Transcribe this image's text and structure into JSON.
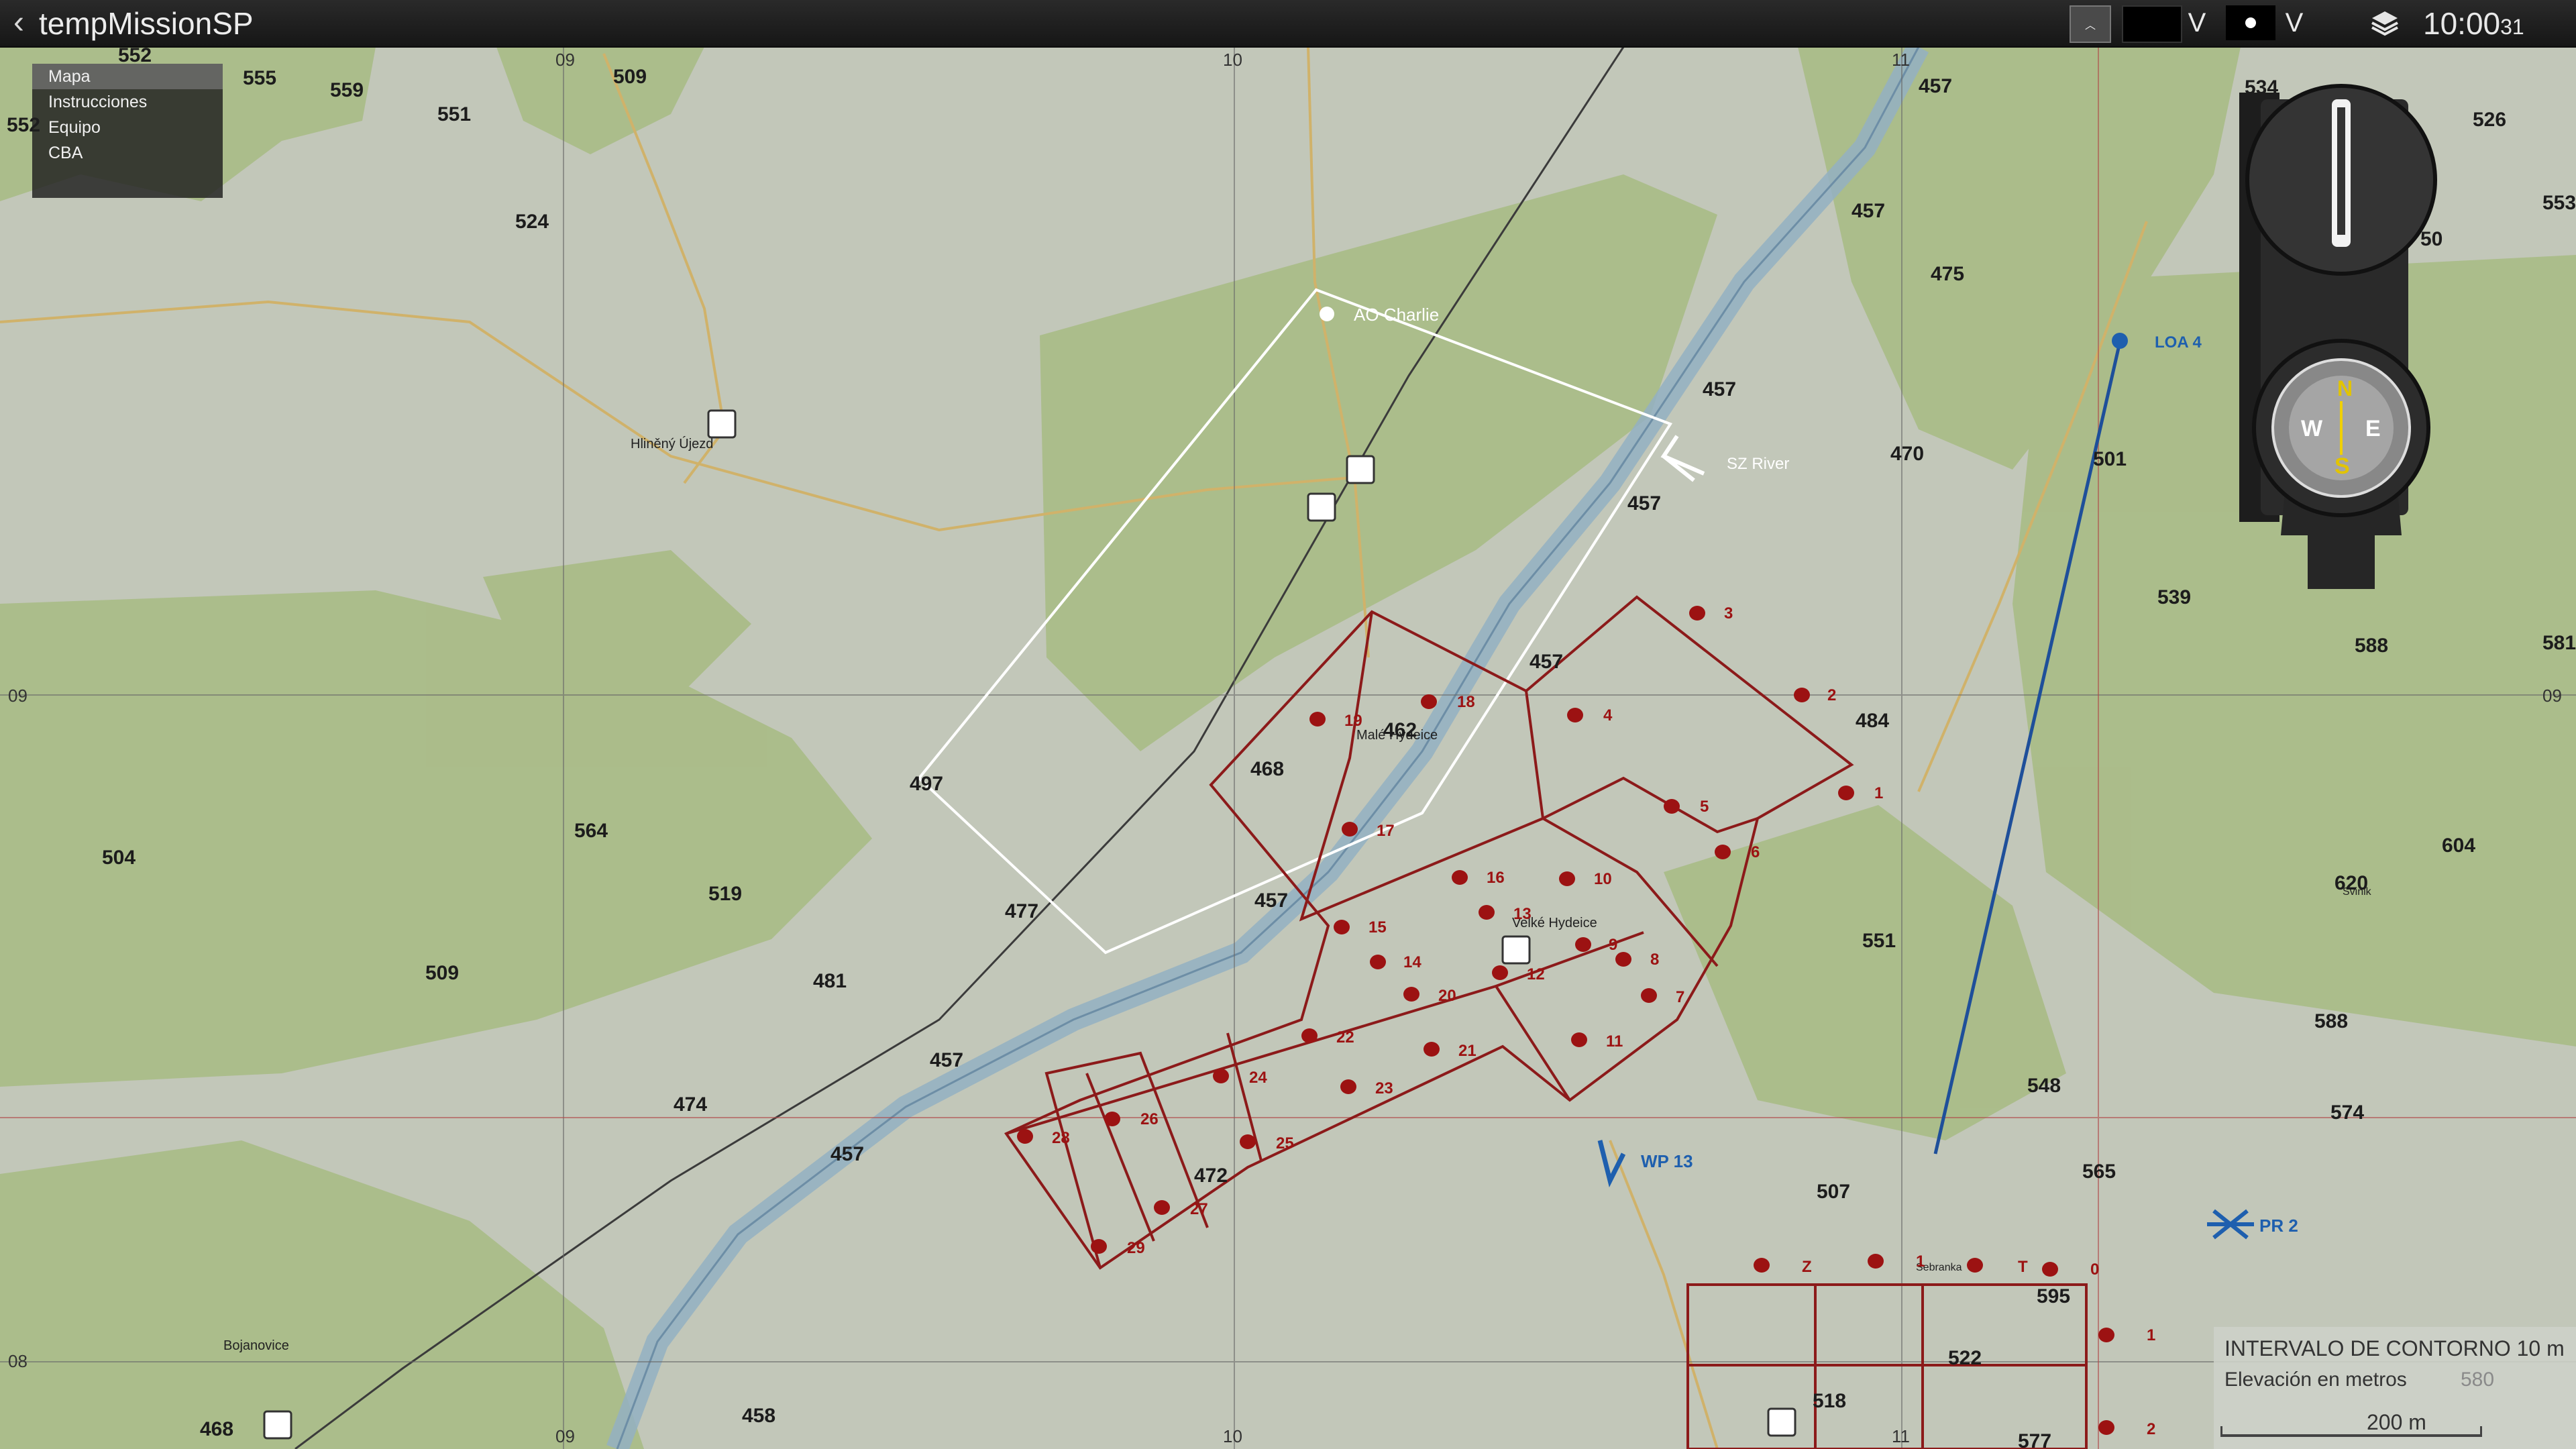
{
  "window": {
    "title": "tempMissionSP"
  },
  "toolbar": {
    "back_icon": "chevron-left-icon",
    "clock_time": "10:00",
    "clock_seconds": "31",
    "v1": "V",
    "v2": "V",
    "icons": [
      "chevron-up-icon",
      "color-swatch-icon",
      "marker-dot-icon",
      "layers-icon"
    ]
  },
  "briefing_menu": {
    "items": [
      "Mapa",
      "Instrucciones",
      "Equipo",
      "CBA"
    ],
    "active": "Mapa"
  },
  "grid": {
    "x_labels": [
      "09",
      "10",
      "11"
    ],
    "y_labels": [
      "09",
      "08"
    ]
  },
  "elevations": [
    "552",
    "555",
    "559",
    "551",
    "509",
    "524",
    "457",
    "534",
    "526",
    "457",
    "475",
    "457",
    "470",
    "501",
    "539",
    "588",
    "484",
    "457",
    "468",
    "462",
    "457",
    "497",
    "504",
    "564",
    "519",
    "509",
    "481",
    "477",
    "457",
    "551",
    "620",
    "604",
    "588",
    "574",
    "457",
    "474",
    "457",
    "472",
    "548",
    "565",
    "507",
    "595",
    "522",
    "518",
    "577",
    "458",
    "468",
    "552",
    "553",
    "50",
    "581"
  ],
  "places": [
    "Hliněný Újezd",
    "Malé Hydeice",
    "Velké Hydeice",
    "Bojanovice",
    "Sebranka",
    "Svinik"
  ],
  "markers": {
    "ao": "AO Charlie",
    "river": "SZ River",
    "loa": "LOA 4",
    "waypoint": "WP 13",
    "pr": "PR 2",
    "sector_numbers": [
      "1",
      "2",
      "3",
      "4",
      "5",
      "6",
      "7",
      "8",
      "9",
      "10",
      "11",
      "12",
      "13",
      "14",
      "15",
      "16",
      "17",
      "18",
      "19",
      "20",
      "21",
      "22",
      "23",
      "24",
      "25",
      "26",
      "27",
      "28",
      "29"
    ],
    "bottom_numbers": [
      "Z",
      "T",
      "0",
      "1",
      "1",
      "2"
    ]
  },
  "legend": {
    "contour": "INTERVALO DE CONTORNO 10 m",
    "elevation": "Elevación en metros",
    "elevation_value": "580",
    "scale": "200 m"
  },
  "colors": {
    "forest": "#a9bb86",
    "field": "#c3c8ba",
    "road": "#d4b46a",
    "river": "#90aec0",
    "sector": "#8c1a1a",
    "ao": "#ffffff",
    "loa": "#1e4f9a"
  }
}
